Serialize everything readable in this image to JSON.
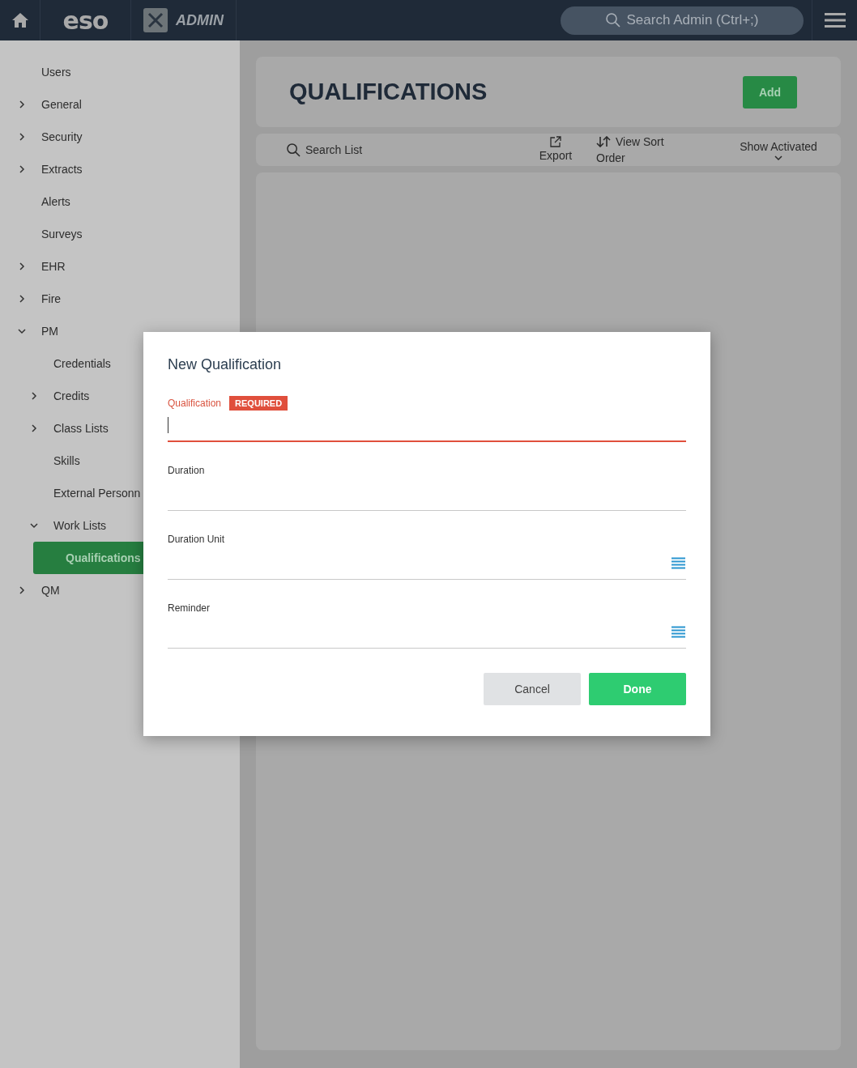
{
  "header": {
    "logo": "eso",
    "app": "ADMIN",
    "search": {
      "placeholder": "Search Admin (Ctrl+;)"
    }
  },
  "sidebar": {
    "items": [
      {
        "label": "Users",
        "selected": false
      },
      {
        "label": "General",
        "expanded": false,
        "selected": false
      },
      {
        "label": "Security",
        "expanded": false,
        "selected": false
      },
      {
        "label": "Extracts",
        "expanded": false,
        "selected": false
      },
      {
        "label": "Alerts",
        "selected": false
      },
      {
        "label": "Surveys",
        "selected": false
      },
      {
        "label": "EHR",
        "expanded": false,
        "selected": false
      },
      {
        "label": "Fire",
        "expanded": false,
        "selected": false
      },
      {
        "label": "PM",
        "expanded": true,
        "selected": false,
        "children": [
          {
            "label": "Credentials",
            "selected": false
          },
          {
            "label": "Credits",
            "expanded": false,
            "selected": false
          },
          {
            "label": "Class Lists",
            "expanded": false,
            "selected": false
          },
          {
            "label": "Skills",
            "selected": false
          },
          {
            "label": "External Personn",
            "selected": false
          },
          {
            "label": "Work Lists",
            "expanded": true,
            "selected": false,
            "children": [
              {
                "label": "Qualifications",
                "selected": true
              }
            ]
          }
        ]
      },
      {
        "label": "QM",
        "expanded": false,
        "selected": false
      }
    ]
  },
  "page": {
    "title": "QUALIFICATIONS",
    "add_button": "Add",
    "toolbar": {
      "search": "Search List",
      "export": "Export",
      "sort": "View Sort Order",
      "filter": "Show Activated"
    }
  },
  "dialog": {
    "title": "New Qualification",
    "fields": [
      {
        "label": "Qualification",
        "kind": "text",
        "required": true,
        "focused": true,
        "badge": "REQUIRED"
      },
      {
        "label": "Duration",
        "kind": "text",
        "required": false
      },
      {
        "label": "Duration Unit",
        "kind": "select",
        "required": false
      },
      {
        "label": "Reminder",
        "kind": "select",
        "required": false
      }
    ],
    "buttons": [
      {
        "label": "Cancel",
        "kind": "secondary"
      },
      {
        "label": "Done",
        "kind": "primary"
      }
    ]
  }
}
